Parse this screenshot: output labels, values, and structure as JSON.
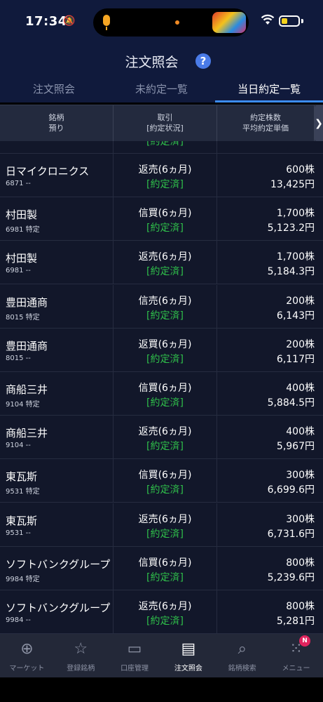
{
  "status_bar": {
    "time": "17:34",
    "battery_level": 0.35
  },
  "header": {
    "title": "注文照会",
    "help_glyph": "?"
  },
  "tabs": [
    {
      "label": "注文照会",
      "active": false
    },
    {
      "label": "未約定一覧",
      "active": false
    },
    {
      "label": "当日約定一覧",
      "active": true
    }
  ],
  "columns": {
    "col1_line1": "銘柄",
    "col1_line2": "預り",
    "col2_line1": "取引",
    "col2_line2": "[約定状況]",
    "col3_line1": "約定株数",
    "col3_line2": "平均約定単価",
    "more_glyph": "❯"
  },
  "partial_row": {
    "state": "[約定済]"
  },
  "rows": [
    {
      "name": "日マイクロニクス",
      "code": "6871 --",
      "trade": "返売(6ヵ月)",
      "state": "[約定済]",
      "qty": "600株",
      "price": "13,425円"
    },
    {
      "name": "村田製",
      "code": "6981 特定",
      "trade": "信買(6ヵ月)",
      "state": "[約定済]",
      "qty": "1,700株",
      "price": "5,123.2円"
    },
    {
      "name": "村田製",
      "code": "6981 --",
      "trade": "返売(6ヵ月)",
      "state": "[約定済]",
      "qty": "1,700株",
      "price": "5,184.3円"
    },
    {
      "name": "豊田通商",
      "code": "8015 特定",
      "trade": "信売(6ヵ月)",
      "state": "[約定済]",
      "qty": "200株",
      "price": "6,143円"
    },
    {
      "name": "豊田通商",
      "code": "8015 --",
      "trade": "返買(6ヵ月)",
      "state": "[約定済]",
      "qty": "200株",
      "price": "6,117円"
    },
    {
      "name": "商船三井",
      "code": "9104 特定",
      "trade": "信買(6ヵ月)",
      "state": "[約定済]",
      "qty": "400株",
      "price": "5,884.5円"
    },
    {
      "name": "商船三井",
      "code": "9104 --",
      "trade": "返売(6ヵ月)",
      "state": "[約定済]",
      "qty": "400株",
      "price": "5,967円"
    },
    {
      "name": "東瓦斯",
      "code": "9531 特定",
      "trade": "信買(6ヵ月)",
      "state": "[約定済]",
      "qty": "300株",
      "price": "6,699.6円"
    },
    {
      "name": "東瓦斯",
      "code": "9531 --",
      "trade": "返売(6ヵ月)",
      "state": "[約定済]",
      "qty": "300株",
      "price": "6,731.6円"
    },
    {
      "name": "ソフトバンクグループ",
      "code": "9984 特定",
      "trade": "信買(6ヵ月)",
      "state": "[約定済]",
      "qty": "800株",
      "price": "5,239.6円"
    },
    {
      "name": "ソフトバンクグループ",
      "code": "9984 --",
      "trade": "返売(6ヵ月)",
      "state": "[約定済]",
      "qty": "800株",
      "price": "5,281円"
    }
  ],
  "bottom_nav": [
    {
      "label": "マーケット",
      "icon": "globe-icon",
      "glyph": "⊕"
    },
    {
      "label": "登録銘柄",
      "icon": "star-icon",
      "glyph": "☆"
    },
    {
      "label": "口座管理",
      "icon": "card-icon",
      "glyph": "▭"
    },
    {
      "label": "注文照会",
      "icon": "document-icon",
      "glyph": "▤",
      "active": true
    },
    {
      "label": "銘柄検索",
      "icon": "search-icon",
      "glyph": "⌕"
    },
    {
      "label": "メニュー",
      "icon": "grid-icon",
      "glyph": "⁙",
      "badge": "N"
    }
  ],
  "colors": {
    "accent": "#3c8cf5",
    "executed": "#2fbf4a",
    "header_bg": "#101a3c",
    "badge": "#e0245e"
  }
}
